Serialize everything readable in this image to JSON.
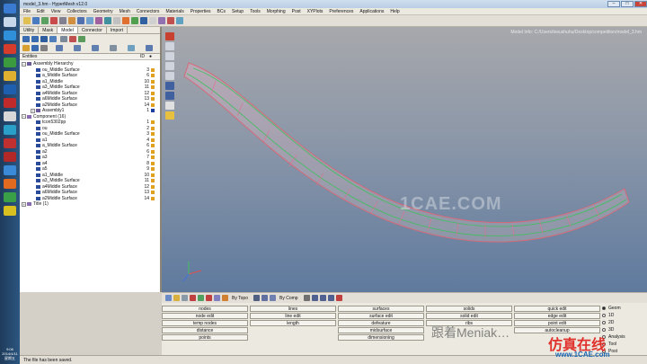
{
  "window": {
    "title": "model_3.hm - HyperMesh v12.0",
    "minimize": "–",
    "maximize": "□",
    "close": "✕"
  },
  "menu": [
    "File",
    "Edit",
    "View",
    "Collectors",
    "Geometry",
    "Mesh",
    "Connectors",
    "Materials",
    "Properties",
    "BCs",
    "Setup",
    "Tools",
    "Morphing",
    "Post",
    "XYPlots",
    "Preferences",
    "Applications",
    "Help"
  ],
  "panel_tabs": [
    "Utility",
    "Mask",
    "Model",
    "Connector",
    "Import"
  ],
  "active_tab": "Model",
  "tree_header": {
    "entities": "Entities",
    "id": "ID"
  },
  "tree": [
    {
      "indent": 0,
      "expander": "−",
      "icon": "assembly",
      "name": "Assembly Hierarchy",
      "id": "",
      "swatch": ""
    },
    {
      "indent": 2,
      "expander": "",
      "icon": "comp",
      "name": "ou_Middle Surface",
      "id": "3",
      "swatch": "#e0a020"
    },
    {
      "indent": 2,
      "expander": "",
      "icon": "comp",
      "name": "a_Middle Surface",
      "id": "6",
      "swatch": "#e0a020"
    },
    {
      "indent": 2,
      "expander": "",
      "icon": "comp",
      "name": "a1_Middle",
      "id": "10",
      "swatch": "#e0a020"
    },
    {
      "indent": 2,
      "expander": "",
      "icon": "comp",
      "name": "a3_Middle Surface",
      "id": "11",
      "swatch": "#e0a020"
    },
    {
      "indent": 2,
      "expander": "",
      "icon": "comp",
      "name": "a4Middle Surface",
      "id": "12",
      "swatch": "#e0a020"
    },
    {
      "indent": 2,
      "expander": "",
      "icon": "comp",
      "name": "a6Middle Surface",
      "id": "13",
      "swatch": "#e0a020"
    },
    {
      "indent": 2,
      "expander": "",
      "icon": "comp",
      "name": "a2Middle Surface",
      "id": "14",
      "swatch": "#e0a020"
    },
    {
      "indent": 2,
      "expander": "+",
      "icon": "assembly",
      "name": "Assembly1",
      "id": "1",
      "swatch": "#1a3fa0"
    },
    {
      "indent": 0,
      "expander": "−",
      "icon": "folder",
      "name": "Component (16)",
      "id": "",
      "swatch": ""
    },
    {
      "indent": 2,
      "expander": "",
      "icon": "comp",
      "name": "tcon5302pp",
      "id": "1",
      "swatch": "#e0a020"
    },
    {
      "indent": 2,
      "expander": "",
      "icon": "comp",
      "name": "ou",
      "id": "2",
      "swatch": "#e0a020"
    },
    {
      "indent": 2,
      "expander": "",
      "icon": "comp",
      "name": "ou_Middle Surface",
      "id": "3",
      "swatch": "#e0a020"
    },
    {
      "indent": 2,
      "expander": "",
      "icon": "comp",
      "name": "a1",
      "id": "4",
      "swatch": "#e0a020"
    },
    {
      "indent": 2,
      "expander": "",
      "icon": "comp",
      "name": "a_Middle Surface",
      "id": "6",
      "swatch": "#e0a020"
    },
    {
      "indent": 2,
      "expander": "",
      "icon": "comp",
      "name": "a2",
      "id": "6",
      "swatch": "#e0a020"
    },
    {
      "indent": 2,
      "expander": "",
      "icon": "comp",
      "name": "a3",
      "id": "7",
      "swatch": "#e0a020"
    },
    {
      "indent": 2,
      "expander": "",
      "icon": "comp",
      "name": "a4",
      "id": "8",
      "swatch": "#e0a020"
    },
    {
      "indent": 2,
      "expander": "",
      "icon": "comp",
      "name": "a5",
      "id": "9",
      "swatch": "#e0a020"
    },
    {
      "indent": 2,
      "expander": "",
      "icon": "comp",
      "name": "a1_Middle",
      "id": "10",
      "swatch": "#e0a020"
    },
    {
      "indent": 2,
      "expander": "",
      "icon": "comp",
      "name": "a3_Middle Surface",
      "id": "11",
      "swatch": "#e0a020"
    },
    {
      "indent": 2,
      "expander": "",
      "icon": "comp",
      "name": "a4Middle Surface",
      "id": "12",
      "swatch": "#e0a020"
    },
    {
      "indent": 2,
      "expander": "",
      "icon": "comp",
      "name": "a6Middle Surface",
      "id": "13",
      "swatch": "#e0a020"
    },
    {
      "indent": 2,
      "expander": "",
      "icon": "comp",
      "name": "a2Middle Surface",
      "id": "14",
      "swatch": "#e0a020"
    },
    {
      "indent": 0,
      "expander": "+",
      "icon": "folder",
      "name": "Title (1)",
      "id": "",
      "swatch": ""
    }
  ],
  "viewport": {
    "info": "Model Info: C:/Users/tesushuhu/Desktop/competition/model_3.hm",
    "watermark": "1CAE.COM"
  },
  "cmdbar": {
    "topo": "By Topo",
    "comp": "By Comp"
  },
  "util_buttons": [
    {
      "label": "nodes",
      "col": 0,
      "row": 0
    },
    {
      "label": "node edit",
      "col": 0,
      "row": 1
    },
    {
      "label": "temp nodes",
      "col": 0,
      "row": 2
    },
    {
      "label": "distance",
      "col": 0,
      "row": 3
    },
    {
      "label": "points",
      "col": 0,
      "row": 4
    },
    {
      "label": "lines",
      "col": 1,
      "row": 0
    },
    {
      "label": "line edit",
      "col": 1,
      "row": 1
    },
    {
      "label": "length",
      "col": 1,
      "row": 2
    },
    {
      "label": "surfaces",
      "col": 2,
      "row": 0
    },
    {
      "label": "surface edit",
      "col": 2,
      "row": 1
    },
    {
      "label": "defeature",
      "col": 2,
      "row": 2
    },
    {
      "label": "midsurface",
      "col": 2,
      "row": 3
    },
    {
      "label": "dimensioning",
      "col": 2,
      "row": 4
    },
    {
      "label": "solids",
      "col": 3,
      "row": 0
    },
    {
      "label": "solid edit",
      "col": 3,
      "row": 1
    },
    {
      "label": "ribs",
      "col": 3,
      "row": 2
    },
    {
      "label": "quick edit",
      "col": 4,
      "row": 0
    },
    {
      "label": "edge edit",
      "col": 4,
      "row": 1
    },
    {
      "label": "point edit",
      "col": 4,
      "row": 2
    },
    {
      "label": "autocleanup",
      "col": 4,
      "row": 3
    }
  ],
  "radios": [
    {
      "label": "Geom",
      "on": true
    },
    {
      "label": "1D",
      "on": false
    },
    {
      "label": "2D",
      "on": false
    },
    {
      "label": "3D",
      "on": false
    },
    {
      "label": "Analysis",
      "on": false
    },
    {
      "label": "Tool",
      "on": false
    },
    {
      "label": "Post",
      "on": false
    }
  ],
  "status": "The file has been saved.",
  "taskbar_time": [
    "9:06",
    "2014/4/11",
    "星期五"
  ],
  "overlay": {
    "wechat": "跟着Meniak…",
    "fangzhen": "仿真在线",
    "site": "www.1CAE.com"
  }
}
